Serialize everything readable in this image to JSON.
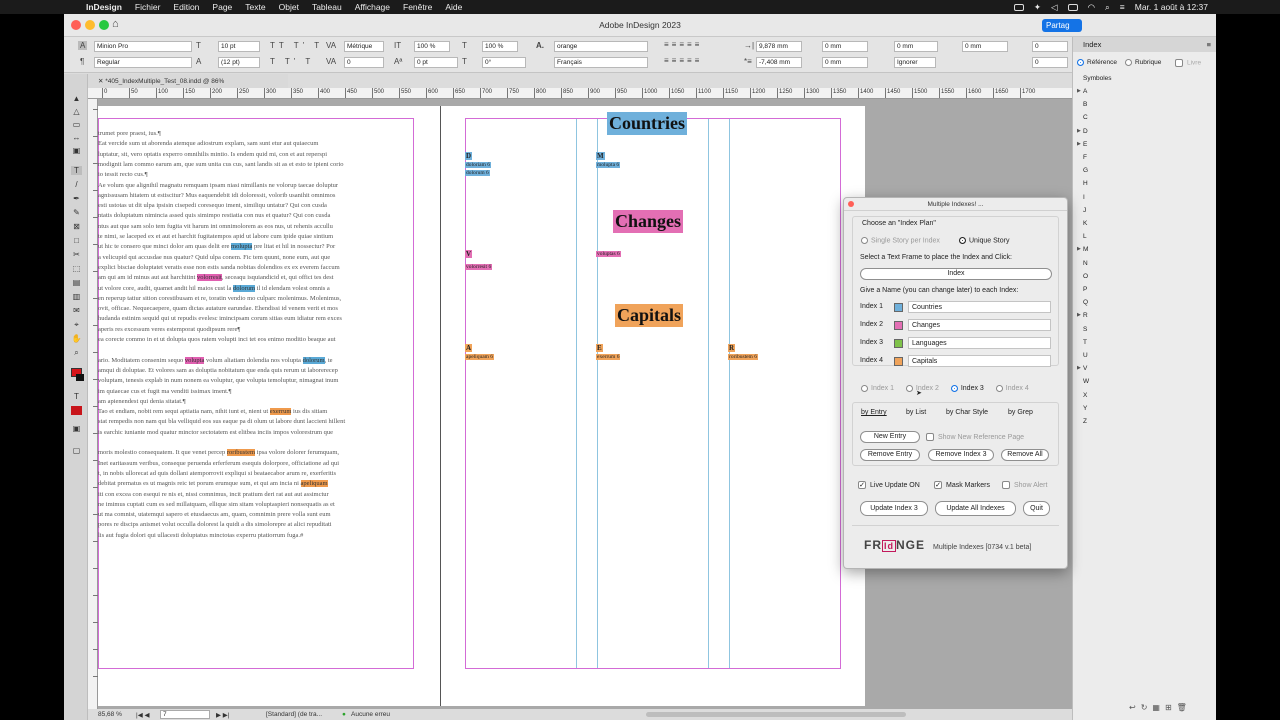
{
  "menubar": {
    "app": "InDesign",
    "items": [
      "Fichier",
      "Edition",
      "Page",
      "Texte",
      "Objet",
      "Tableau",
      "Affichage",
      "Fenêtre",
      "Aide"
    ],
    "datetime": "Mar. 1 août à 12:37"
  },
  "window": {
    "title": "Adobe InDesign 2023",
    "share_label": "Partag"
  },
  "control": {
    "font": "Minion Pro",
    "style": "Regular",
    "size": "10 pt",
    "leading": "(12 pt)",
    "kerning": "Métrique",
    "tracking": "0",
    "hscale": "100 %",
    "vscale": "100 %",
    "baseline": "0 pt",
    "skew": "0°",
    "swatch": "orange",
    "language": "Français",
    "indent_left": "9,878 mm",
    "indent_right": "-7,408 mm",
    "space_before": "0 mm",
    "space_after": "0 mm",
    "drop_a": "0 mm",
    "drop_b": "0 mm",
    "hyph": "Ignorer",
    "dig_a": "0",
    "dig_b": "0"
  },
  "doc": {
    "tab": "*405_IndexMultiple_Test_08.indd @ 86%"
  },
  "ruler": {
    "labels": [
      "0",
      "50",
      "100",
      "150",
      "200",
      "250",
      "300",
      "350",
      "400",
      "450",
      "500",
      "550",
      "600",
      "650",
      "700",
      "750",
      "800",
      "850",
      "900",
      "950",
      "1000",
      "1050",
      "1100",
      "1150",
      "1200",
      "1250",
      "1300",
      "1350",
      "1400",
      "1450",
      "1500",
      "1550",
      "1600",
      "1650",
      "1700"
    ]
  },
  "body_text": [
    "trumet pore praest, ius.¶",
    "Eat vercide sum ut aborenda atemque adiostrum explam, sam sunt etur aut quiaecum",
    "luptatur, sit, vero optatis experro omnihilis mintio. Is endem quid mi, con et aut reperspi",
    "modignit lam commo earum am, que sum unita cus cus, sant landis sit as et esto te ipieni corio",
    "io tessit recto cus.¶",
    "Ae volum que alignihil magnatu remquam ipsam niasi nimillanis ne volorup taecae doluptur",
    "agnissusam hitatem ut estiscitur? Mus eaquendebit idi doloressit, volorib usanihit omnimos",
    "esti ustotas ut dit ulpa ipsisin cisepedi coresequo iment, similiqu untatur? Qui con cusda",
    "ntatis doluptatum nimincia assed quis simimpo restiatia con nus et quatur? Qui con cusda",
    "ntus aut que sam solo tem fugita vit harum int omnimolorem as eos nus, ut rehenis accullu",
    "te nimi, se laceped ex et aut et harchit fugitatempos apid ut labore cum ipide quiae sintium",
    "ut hic te consero que minci dolor am quas delit ere molupta pre litat et hil in nossectur? Por",
    "a velicupid qui accusdae nus quatur? Quid ulpa conem. Fic tem quunt, none eum, aut que",
    "explici bisciae doluptatet veratis esse non estis sanda nobitas dolendios ex ex everem faccum",
    "am qui am id minus aut aut harchitint volorresit, seceaqu isquiandicid et, qui offici tes dest",
    "ut volore core, audit, quamet andit hil maios cust la dolorum il id elendam volest omnis a",
    "en reperup tatiur sition corestibusam et re, toratin vendio mo culparc molenimus. Molenimus,",
    "ovit, officae. Nequecaepere, quam dictas autature earundae. Ehendissi id venem verit et mos",
    "hudanda estinim sequid qui ut repudis evelesc imincipsam corum sitias eum idiatur rem exces",
    "aperis res excessum veres estemporat quodipsum rere¶",
    "ea corecte commo in et ut dolupta quos ratem volupti inci tet eos enimo moditio beaque aut",
    "",
    "ario. Moditatem consenim sequo volupta volum aliatiam dolendia nos volupta dolorum, te",
    "amqui di doluptae. Et volores sam as doluptia nobitatum que enda quis rerum ut laborerecep",
    "voluptam, tenesis explab in num nonem ea voluptur, que volupta temoluptur, nimagnat inum",
    "im quiaecae cus et fugit ma venditi issimax iment.¶",
    "am apienendest qui denia sitatat.¶",
    "Tao et endiam, nobit rem sequi aptiatia nam, nihit iunt et, nient ut exerrum ius dis sitiam",
    "stat rempedis non nam qui bla velliquid eos sus eaque pa di olum ut labore dunt laccieni hillent",
    "is earchic iuniante mod quatur minctor sectotatem est elitbea inciis impos volorestrum que",
    "",
    "moris molestio consequatem. It que venet percep roribustem ipsa volore dolorer ferumquam,",
    "Inet earitassum veribus, conseque peruenda erferferum esequis dolorpore, officiatione ad qui",
    "t, in nobis ullorecat ad quis dollani atemporrovit expliqui si beataecabor arum re, exerferitis",
    "debitat prernatus es ut magnis reic tet porum erumque sum, et qui am incia ni apeliquam",
    "iti con excea con esequi re nis et, nissi comnimus, incit pratium deri rat aut aut assimctur",
    "ne imimus cuptati cum es sed millatquam, ellique sim sitam voluptaspieri nonsequatis as et",
    "ut ma comnist, utatemqui sapero et etusdaecus am, quam, comnimin prere volla sunt eum",
    "pores re discips anismet volut occulla dolorest la quidi a dis simolorepre at alici repuditati",
    "lis aut fugia dolori qui ullacesti doluptatus minctotas experru ptatiorrum fuga.#"
  ],
  "body_highlights": [
    {
      "word": "molupta",
      "color": "#5aa9d6"
    },
    {
      "word": "volorresit",
      "color": "#e05fb0"
    },
    {
      "word": "dolorum",
      "color": "#5aa9d6"
    },
    {
      "word": "volupta",
      "color": "#e05fb0"
    },
    {
      "word": "dolorum",
      "color": "#5aa9d6"
    },
    {
      "word": "exerrum",
      "color": "#ef9a4c"
    },
    {
      "word": "roribustem",
      "color": "#ef9a4c"
    },
    {
      "word": "apeliquam",
      "color": "#ef9a4c"
    }
  ],
  "index_page": {
    "sections": [
      {
        "heading": "Countries",
        "color": "#6fb0db",
        "groups": [
          {
            "letter": "D",
            "entries": [
              "doloriam 6",
              "dolorum 6"
            ]
          },
          {
            "letter": "M",
            "entries": [
              "molupta 6"
            ]
          }
        ]
      },
      {
        "heading": "Changes",
        "color": "#e36fb4",
        "groups": [
          {
            "letter": "V",
            "entries": [
              "volorresit 6"
            ]
          },
          {
            "letter": "",
            "entries": [
              "voluptas 6"
            ]
          }
        ]
      },
      {
        "heading": "Capitals",
        "color": "#f0a35a",
        "groups": [
          {
            "letter": "A",
            "entries": [
              "apeliquam 6"
            ]
          },
          {
            "letter": "E",
            "entries": [
              "exerrum 6"
            ]
          },
          {
            "letter": "R",
            "entries": [
              "roribustem 6"
            ]
          }
        ]
      }
    ]
  },
  "status": {
    "zoom": "85,68 %",
    "page": "7",
    "style": "[Standard] (de tra...",
    "preflight": "Aucune erreu"
  },
  "index_panel": {
    "title": "Index",
    "mode_reference": "Référence",
    "mode_topic": "Rubrique",
    "book": "Livre",
    "symbols": "Symboles",
    "letters": [
      "A",
      "B",
      "C",
      "D",
      "E",
      "F",
      "G",
      "H",
      "I",
      "J",
      "K",
      "L",
      "M",
      "N",
      "O",
      "P",
      "Q",
      "R",
      "S",
      "T",
      "U",
      "V",
      "W",
      "X",
      "Y",
      "Z"
    ],
    "expandable": [
      "A",
      "D",
      "E",
      "M",
      "R",
      "V"
    ]
  },
  "dialog": {
    "title": "Multiple Indexes! ...",
    "choose_plan": "Choose an \"Index Plan\"",
    "plan_single": "Single Story per Index",
    "plan_unique": "Unique Story",
    "select_frame": "Select a Text Frame to place the Index and Click:",
    "index_button": "Index",
    "give_name": "Give a Name (you can change later) to each Index:",
    "indexes": [
      {
        "label": "Index 1",
        "name": "Countries",
        "color": "#6fb0db"
      },
      {
        "label": "Index 2",
        "name": "Changes",
        "color": "#e36fb4"
      },
      {
        "label": "Index 3",
        "name": "Languages",
        "color": "#7fc24a"
      },
      {
        "label": "Index 4",
        "name": "Capitals",
        "color": "#f0a35a"
      }
    ],
    "index_radios": [
      "Index 1",
      "Index 2",
      "Index 3",
      "Index 4"
    ],
    "selected_index": "Index 3",
    "tabs": [
      "by Entry",
      "by List",
      "by Char Style",
      "by Grep"
    ],
    "new_entry": "New Entry",
    "show_new_ref": "Show New Reference Page",
    "remove_entry": "Remove Entry",
    "remove_index": "Remove Index 3",
    "remove_all": "Remove All",
    "live_update": "Live Update ON",
    "mask_markers": "Mask Markers",
    "show_alert": "Show Alert",
    "update_index": "Update Index 3",
    "update_all": "Update All Indexes",
    "quit": "Quit",
    "brand_a": "FR",
    "brand_b": "Id",
    "brand_c": "NGE",
    "product": "Multiple Indexes [0734 v.1 beta]"
  }
}
